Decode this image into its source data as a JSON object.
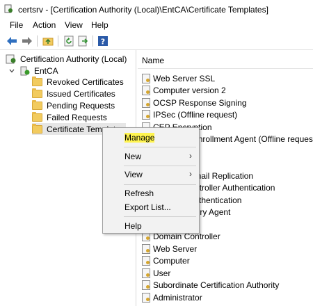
{
  "window": {
    "title": "certsrv - [Certification Authority (Local)\\EntCA\\Certificate Templates]"
  },
  "menubar": {
    "items": [
      "File",
      "Action",
      "View",
      "Help"
    ]
  },
  "toolbar": {
    "buttons": [
      "back-icon",
      "forward-icon",
      "up-folder-icon",
      "refresh-icon",
      "export-icon",
      "help-icon"
    ]
  },
  "tree": {
    "root": "Certification Authority (Local)",
    "ca": "EntCA",
    "folders": [
      "Revoked Certificates",
      "Issued Certificates",
      "Pending Requests",
      "Failed Requests",
      "Certificate Templates"
    ]
  },
  "list": {
    "header": "Name",
    "rows": [
      "Web Server SSL",
      "Computer version 2",
      "OCSP Response Signing",
      "IPSec (Offline request)",
      "CEP Encryption",
      "Exchange Enrollment Agent (Offline request)",
      "",
      "",
      "Directory Email Replication",
      "Domain Controller Authentication",
      "Kerberos Authentication",
      "EFS Recovery Agent",
      "",
      "Domain Controller",
      "Web Server",
      "Computer",
      "User",
      "Subordinate Certification Authority",
      "Administrator"
    ]
  },
  "context_menu": {
    "items": [
      {
        "label": "Manage",
        "highlighted": true
      },
      {
        "label": "New",
        "submenu": true
      },
      {
        "label": "View",
        "submenu": true
      },
      {
        "label": "Refresh"
      },
      {
        "label": "Export List..."
      },
      {
        "label": "Help"
      }
    ],
    "submenu_arrow": "›",
    "highlight_color": "#fff44f"
  }
}
